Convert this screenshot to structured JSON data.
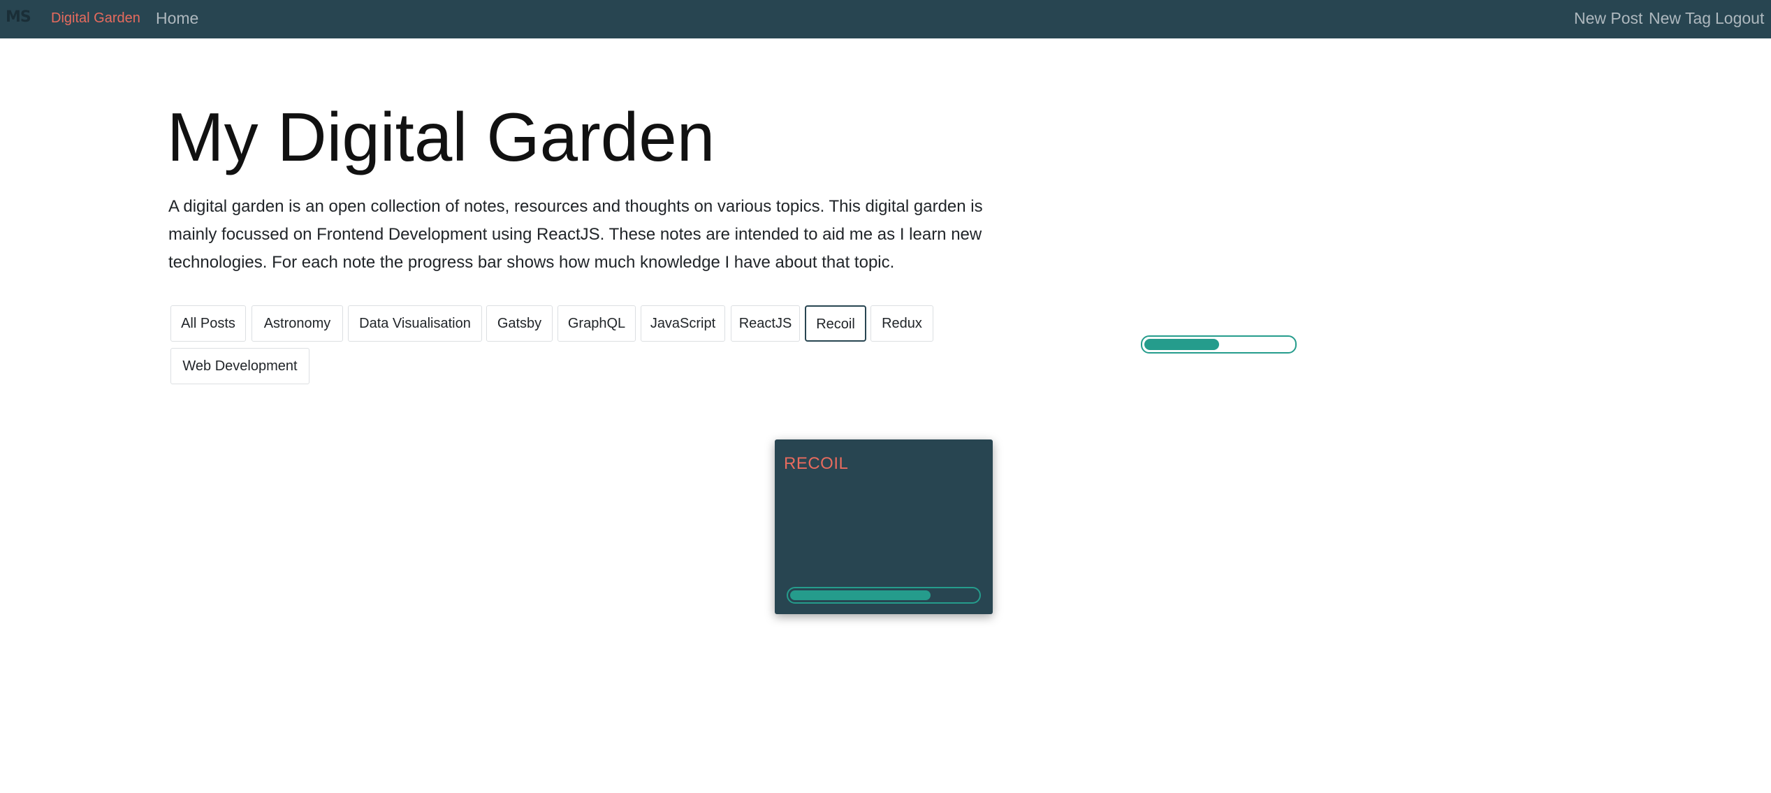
{
  "navbar": {
    "logo": "MS",
    "brand": "Digital Garden",
    "home": "Home",
    "new_post": "New Post",
    "new_tag": "New Tag",
    "logout": "Logout"
  },
  "hero": {
    "title": "My Digital Garden",
    "intro": "A digital garden is an open collection of notes, resources and thoughts on various topics. This digital garden is mainly focussed on Frontend Development using ReactJS. These notes are intended to aid me as I learn new technologies. For each note the progress bar shows how much knowledge I have about that topic."
  },
  "tags": [
    {
      "label": "All Posts",
      "active": false
    },
    {
      "label": "Astronomy",
      "active": false
    },
    {
      "label": "Data Visualisation",
      "active": false
    },
    {
      "label": "Gatsby",
      "active": false
    },
    {
      "label": "GraphQL",
      "active": false
    },
    {
      "label": "JavaScript",
      "active": false
    },
    {
      "label": "ReactJS",
      "active": false
    },
    {
      "label": "Recoil",
      "active": true
    },
    {
      "label": "Redux",
      "active": false
    },
    {
      "label": "Web Development",
      "active": false
    }
  ],
  "standalone_progress": {
    "value": 0.5
  },
  "posts": [
    {
      "title": "RECOIL",
      "progress": 0.75
    }
  ],
  "colors": {
    "navbar": "#284551",
    "brand": "#e76b5e",
    "progress": "#259c8c"
  }
}
